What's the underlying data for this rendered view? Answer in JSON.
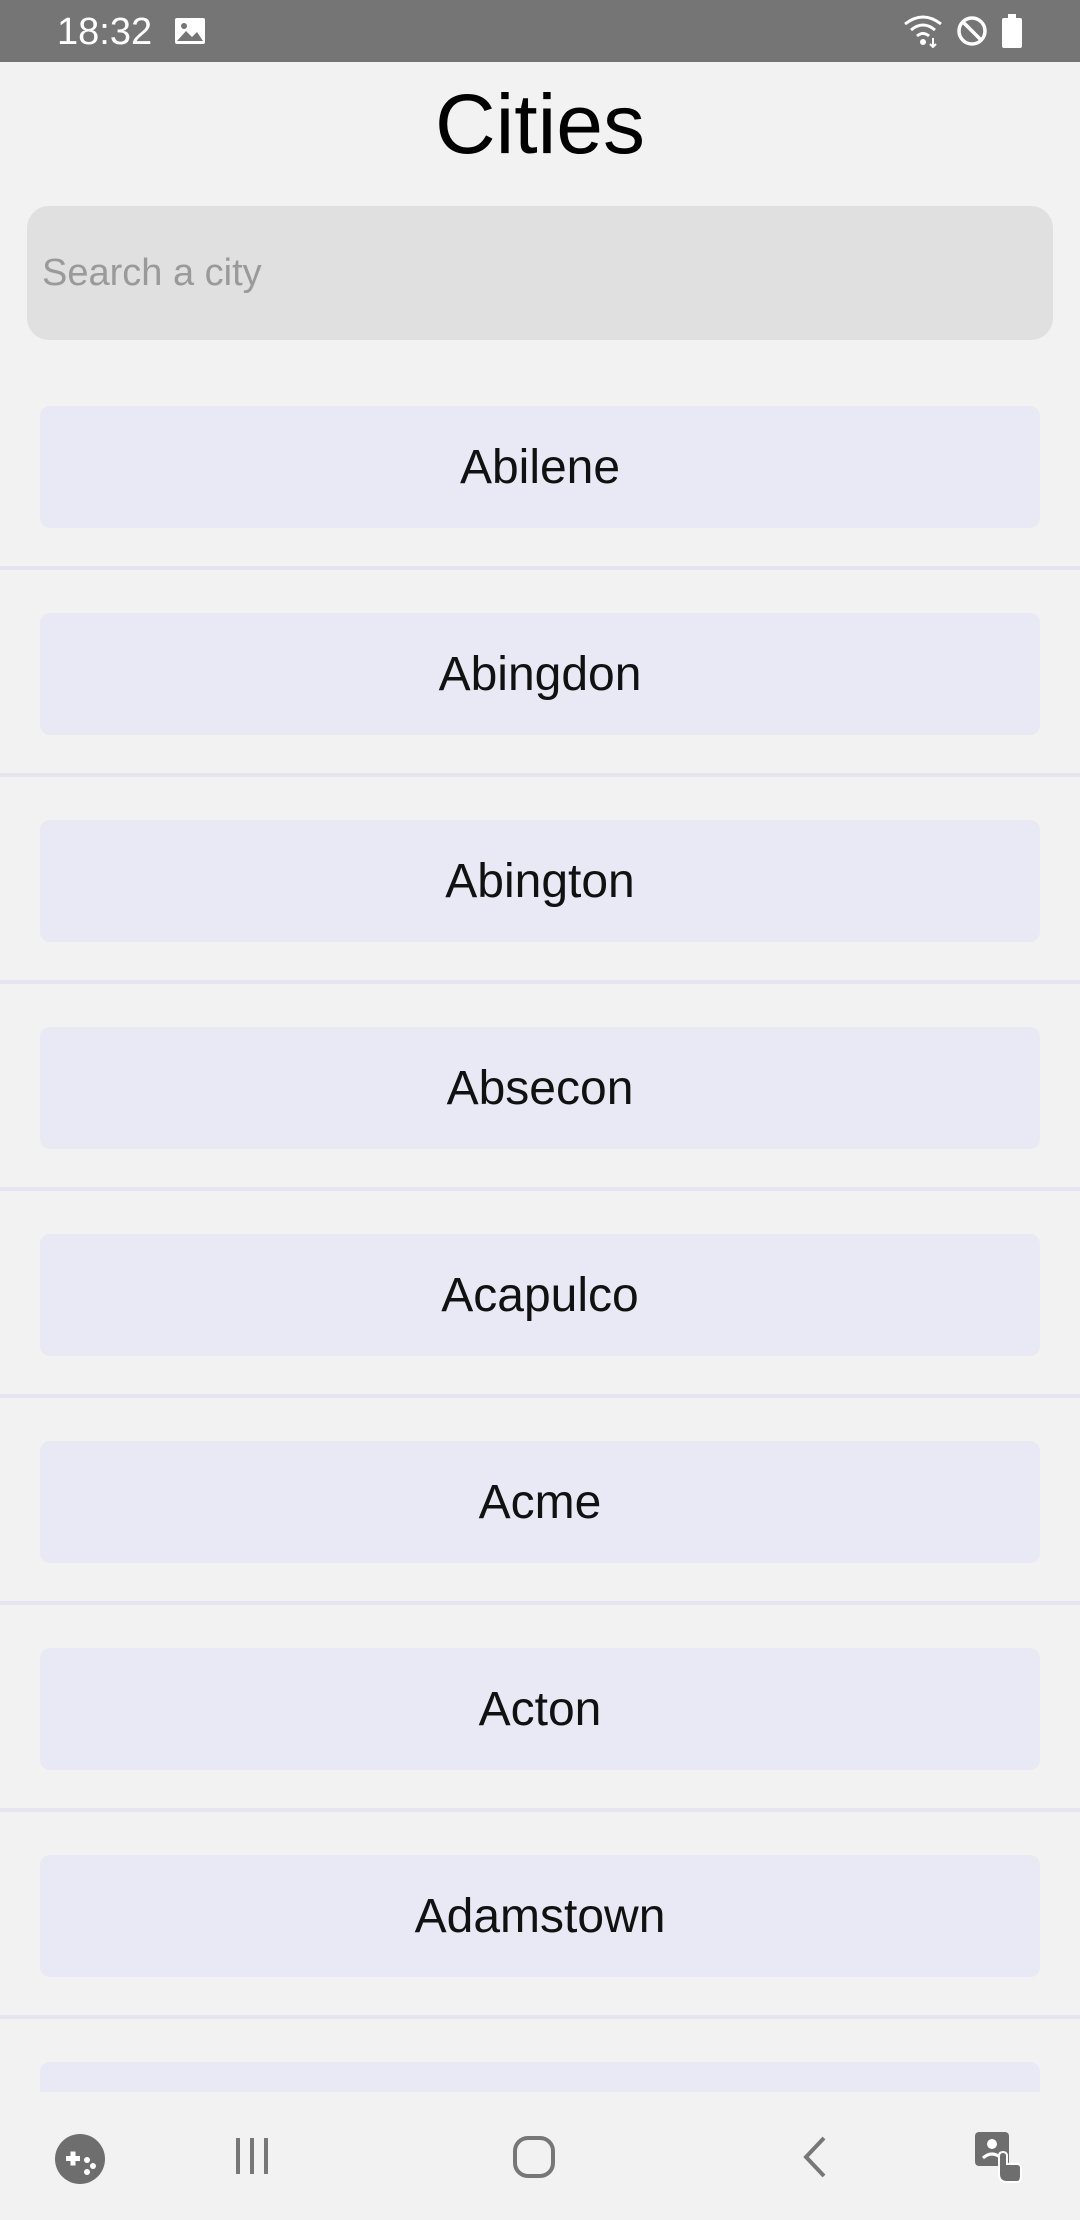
{
  "status_bar": {
    "time": "18:32",
    "icons": [
      "image-icon",
      "wifi-icon",
      "do-not-disturb-icon",
      "battery-icon"
    ]
  },
  "page": {
    "title": "Cities"
  },
  "search": {
    "placeholder": "Search a city",
    "value": ""
  },
  "cities": [
    "Abilene",
    "Abingdon",
    "Abington",
    "Absecon",
    "Acapulco",
    "Acme",
    "Acton",
    "Adamstown",
    ""
  ],
  "nav_bar": {
    "icons": [
      "game-launcher-icon",
      "recent-apps-icon",
      "home-icon",
      "back-icon",
      "accessibility-icon"
    ]
  },
  "colors": {
    "status_bar_bg": "#757575",
    "background": "#f2f2f2",
    "search_bg": "#e0e0e0",
    "city_button_bg": "#e8e9f4",
    "divider": "#e6e4ee"
  }
}
